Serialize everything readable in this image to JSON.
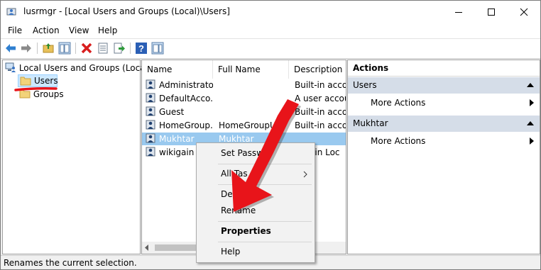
{
  "window": {
    "title": "lusrmgr - [Local Users and Groups (Local)\\Users]",
    "controls": [
      "minimize",
      "maximize",
      "close"
    ]
  },
  "menu": [
    "File",
    "Action",
    "View",
    "Help"
  ],
  "toolbar": [
    "back-icon",
    "forward-icon",
    "up-folder-icon",
    "show-tree-icon",
    "delete-icon",
    "properties-icon",
    "export-icon",
    "help-icon",
    "show-action-pane-icon"
  ],
  "tree": {
    "root": "Local Users and Groups (Local)",
    "items": [
      "Users",
      "Groups"
    ],
    "selected": "Users"
  },
  "list": {
    "columns": [
      "Name",
      "Full Name",
      "Description"
    ],
    "rows": [
      {
        "name": "Administrator",
        "full_name": "",
        "description": "Built-in accou"
      },
      {
        "name": "DefaultAcco...",
        "full_name": "",
        "description": "A user accou"
      },
      {
        "name": "Guest",
        "full_name": "",
        "description": "Built-in accou"
      },
      {
        "name": "HomeGroup...",
        "full_name": "HomeGroupUs",
        "description": "Built-in accou"
      },
      {
        "name": "Mukhtar",
        "full_name": "Mukhtar",
        "description": ""
      },
      {
        "name": "wikigain",
        "full_name": "",
        "description": "ain Loc"
      }
    ],
    "selected_row": "Mukhtar"
  },
  "actions": {
    "title": "Actions",
    "sections": [
      {
        "header": "Users",
        "items": [
          "More Actions"
        ]
      },
      {
        "header": "Mukhtar",
        "items": [
          "More Actions"
        ]
      }
    ]
  },
  "context_menu": {
    "items": [
      "Set Passwo",
      "All Tas",
      "Delete",
      "Rename",
      "Properties",
      "Help"
    ]
  },
  "status": "Renames the current selection.",
  "colors": {
    "selection": "#99c9ef",
    "tree_selection": "#cce8ff",
    "pane_header": "#d5dde8",
    "annotation_red": "#e8141a"
  }
}
